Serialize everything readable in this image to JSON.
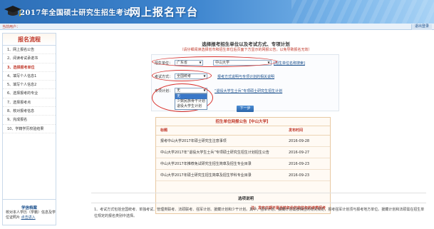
{
  "banner": {
    "title_main": "2017年全国硕士研究生招生考试",
    "title_sub": "网上报名平台"
  },
  "infobar": {
    "user_label": "当前用户：",
    "logout_label": "退出登录"
  },
  "sidebar": {
    "heading": "报名流程",
    "items": [
      {
        "label": "1、网上报名公告"
      },
      {
        "label": "2、阅读考试承诺书"
      },
      {
        "label": "3、选择报考单位"
      },
      {
        "label": "4、填写个人信息1"
      },
      {
        "label": "5、填写个人信息2"
      },
      {
        "label": "6、选择报考的专业"
      },
      {
        "label": "7、选择报考点"
      },
      {
        "label": "8、核对报考信息"
      },
      {
        "label": "9、完成报名"
      },
      {
        "label": "10、学籍学历校验结果"
      }
    ],
    "section_title": "学信档案",
    "section_text": "校对本人学历（学籍）信息及学位证照片",
    "section_link": "点击进入"
  },
  "main": {
    "title": "选择报考招生单位以及考试方式、专项计划",
    "note": "（请仔细阅读选择省市和招生单位后页面下方显示的网报公告，以免导致报名无效）",
    "form": {
      "unit_label": "招生单位：",
      "province": "广东省",
      "school": "中山大学",
      "unit_link": "[招生单位名称搜索]",
      "method_label": "考试方式：",
      "method": "全国统考",
      "method_link": "报考方式说明与专项计划的相关说明",
      "plan_label": "专项计划：",
      "plan": "无",
      "plan_link": "“退役大学生士兵”专项硕士研究生招生计划",
      "plan_options": [
        "无",
        "少数民族骨干计划",
        "退役大学生计划"
      ]
    },
    "next_button": "下一步",
    "notice": {
      "title": "招生单位网报公告【中山大学】",
      "col_title": "标题",
      "col_time": "发布时间",
      "rows": [
        {
          "title": "报考中山大学2017年硕士研究生注意事项",
          "time": "2016-09-28"
        },
        {
          "title": "中山大学2017年“退役大学生士兵”专项硕士研究生招生计划招生公告",
          "time": "2016-09-27"
        },
        {
          "title": "中山大学2017年推荐免试研究生招生简章及招生专业目录",
          "time": "2016-09-23"
        },
        {
          "title": "中山大学2017年硕士研究生招生简章及招生学科专业目录",
          "time": "2016-09-23"
        }
      ],
      "footer": "注：发布日期不是当前年份的非往年的该类招考"
    },
    "instr_title": "选项说明",
    "instr_text": "1、考试方式包括全国统考、单独考试、管理类联考、法硕联考、强军计划、援藏计划和少干计划。其中，强军计划、援藏计划需按相应的有关规定，报考强军计划须与报考地方单位。援藏计划和法硕需在招生单位规定的报名类别中选择。"
  },
  "colors": {
    "banner_blue": "#2d6fb8",
    "accent_red": "#c0392b",
    "link_blue": "#1a4f8c"
  }
}
